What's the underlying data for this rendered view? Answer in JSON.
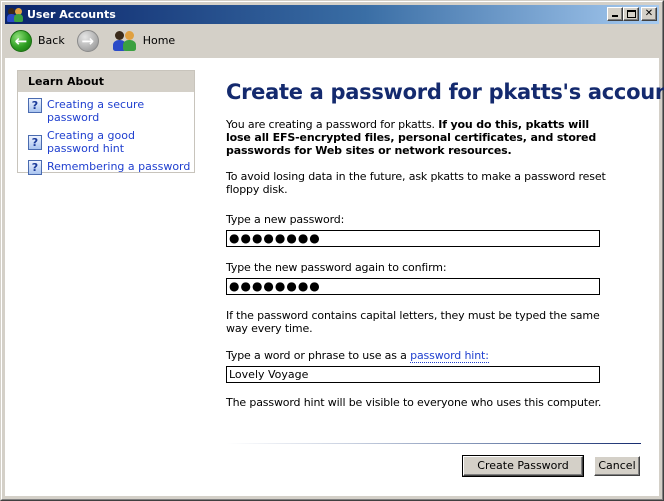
{
  "window": {
    "title": "User Accounts",
    "controls": {
      "minimize": "minimize",
      "maximize": "maximize",
      "close": "✕"
    }
  },
  "toolbar": {
    "back_label": "Back",
    "forward_label": "",
    "home_label": "Home"
  },
  "learn_about": {
    "header": "Learn About",
    "items": [
      {
        "label": "Creating a secure password",
        "icon": "help-icon"
      },
      {
        "label": "Creating a good password hint",
        "icon": "help-icon"
      },
      {
        "label": "Remembering a password",
        "icon": "help-icon"
      }
    ]
  },
  "main": {
    "title": "Create a password for pkatts's account",
    "intro_plain": "You are creating a password for pkatts.",
    "intro_bold": "If you do this, pkatts will lose all EFS-encrypted files, personal certificates, and stored passwords for Web sites or network resources.",
    "reset_note": "To avoid losing data in the future, ask pkatts to make a password reset floppy disk.",
    "new_password_label": "Type a new password:",
    "new_password_value": "●●●●●●●●",
    "confirm_password_label": "Type the new password again to confirm:",
    "confirm_password_value": "●●●●●●●●",
    "caps_note": "If the password contains capital letters, they must be typed the same way every time.",
    "hint_label_prefix": "Type a word or phrase to use as a ",
    "hint_link": "password hint:",
    "hint_value": "Lovely Voyage",
    "hint_visibility_note": "The password hint will be visible to everyone who uses this computer."
  },
  "buttons": {
    "create": "Create Password",
    "cancel": "Cancel"
  },
  "colors": {
    "title_text": "#142a6e",
    "link": "#1f3fcf",
    "titlebar_start": "#0a246a",
    "titlebar_end": "#a6caf0"
  }
}
